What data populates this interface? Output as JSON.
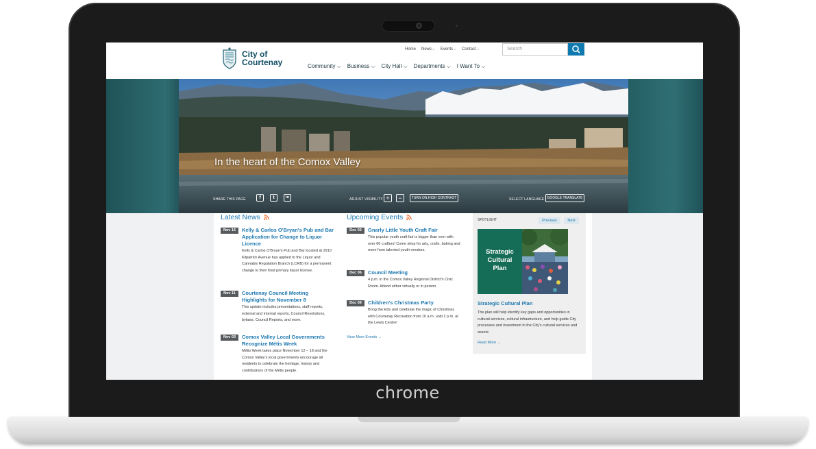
{
  "device": {
    "brand_label": "chrome"
  },
  "site": {
    "logo": {
      "line1": "City of",
      "line2": "Courtenay"
    },
    "utility_nav": [
      {
        "label": "Home",
        "has_dropdown": false
      },
      {
        "label": "News",
        "has_dropdown": true
      },
      {
        "label": "Events",
        "has_dropdown": true
      },
      {
        "label": "Contact",
        "has_dropdown": true
      }
    ],
    "search": {
      "placeholder": "Search"
    },
    "main_nav": [
      {
        "label": "Community"
      },
      {
        "label": "Business"
      },
      {
        "label": "City Hall"
      },
      {
        "label": "Departments"
      },
      {
        "label": "I Want To"
      }
    ]
  },
  "hero": {
    "title": "In the heart of the Comox Valley"
  },
  "utility_bar": {
    "share_label": "SHARE THIS PAGE",
    "share_icons": [
      "f",
      "t",
      "in"
    ],
    "visibility_label": "ADJUST VISIBILITY",
    "plus": "+",
    "minus": "−",
    "contrast_button": "TURN ON HIGH CONTRAST",
    "language_label": "SELECT LANGUAGE",
    "translate_button": "GOOGLE TRANSLATE"
  },
  "news": {
    "heading": "Latest News",
    "items": [
      {
        "date": "Nov 16",
        "title": "Kelly & Carlos O'Bryan's Pub and Bar Application for Change to Liquor Licence",
        "desc": "Kelly & Carlos O'Bryan's Pub and Bar located at 2910 Kilpatrick Avenue has applied to the Liquor and Cannabis Regulation Branch (LCRB) for a permanent change to their food primary liquor license."
      },
      {
        "date": "Nov 11",
        "title": "Courtenay Council Meeting Highlights for November 8",
        "desc": "This update includes presentations, staff reports, external and internal reports, Council Resolutions, bylaws, Council Reports, and more."
      },
      {
        "date": "Nov 03",
        "title": "Comox Valley Local Governments Recognize Métis Week",
        "desc": "Métis Week takes place November 12 – 18 and the Comox Valley's local governments encourage all residents to celebrate the heritage, history and contributions of the Métis people."
      }
    ]
  },
  "events": {
    "heading": "Upcoming Events",
    "items": [
      {
        "date": "Dec 03",
        "title": "Gnarly Little Youth Craft Fair",
        "desc": "This popular youth craft fair is bigger than ever with over 60 crafters! Come shop for arts, crafts, baking and more from talented youth vendors."
      },
      {
        "date": "Dec 06",
        "title": "Council Meeting",
        "desc": "4 p.m. in the Comox Valley Regional District's Civic Room. Attend either virtually or in person."
      },
      {
        "date": "Dec 09",
        "title": "Children's Christmas Party",
        "desc": "Bring the kids and celebrate the magic of Christmas with Courtenay Recreation from 10 a.m. until 2 p.m. at the Lewis Centre!"
      }
    ],
    "more_link": "View More Events →"
  },
  "spotlight": {
    "label": "SPOTLIGHT",
    "prev": "Previous",
    "next": "Next",
    "image_text": [
      "Strategic",
      "Cultural",
      "Plan"
    ],
    "title": "Strategic Cultural Plan",
    "desc": "The plan will help identify key gaps and opportunities in cultural services, cultural infrastructure, and help guide City processes and investment in the City's cultural services and assets.",
    "more_link": "Read More →"
  },
  "colors": {
    "brand": "#0f4d64",
    "link": "#1b77b0",
    "search_button": "#0f7ab0",
    "spotlight_green": "#166d57",
    "date_badge": "#575a5d"
  }
}
